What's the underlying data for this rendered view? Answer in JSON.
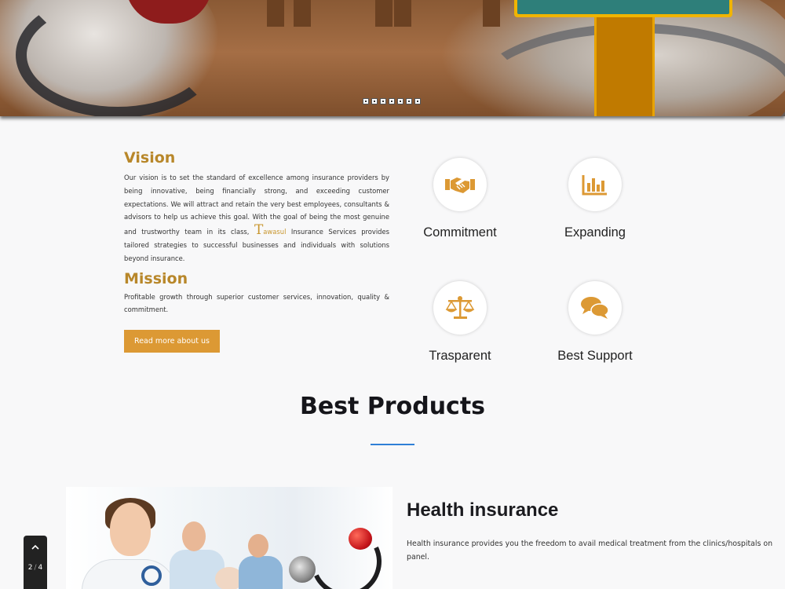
{
  "hero": {
    "slide_count": 7
  },
  "vision": {
    "heading": "Vision",
    "text_before_brand": "Our vision is to set the standard of excellence among insurance providers by being innovative, being financially strong, and exceeding customer expectations. We will attract and retain the very best employees, consultants & advisors to help us achieve this goal. With the goal of being the most genuine and trustworthy team in its class,",
    "brand_first_letter": "T",
    "brand_rest": "awasul",
    "text_after_brand": "Insurance Services provides tailored strategies to successful businesses and individuals with solutions beyond insurance."
  },
  "mission": {
    "heading": "Mission",
    "text": "Profitable growth through superior customer services, innovation, quality & commitment."
  },
  "read_more_label": "Read more about us",
  "features": [
    {
      "label": "Commitment",
      "icon": "handshake-icon"
    },
    {
      "label": "Expanding",
      "icon": "bar-chart-icon"
    },
    {
      "label": "Trasparent",
      "icon": "balance-scale-icon"
    },
    {
      "label": "Best Support",
      "icon": "chat-bubbles-icon"
    }
  ],
  "accent_colors": {
    "gold": "#b8872a",
    "button": "#dc9934",
    "blue_line": "#2f7fd6",
    "icon": "#dc9934"
  },
  "products": {
    "title": "Best Products",
    "items": [
      {
        "title": "Health insurance",
        "description": "Health insurance provides you the freedom to avail medical treatment from the clinics/hospitals on panel."
      }
    ]
  },
  "pager": {
    "current": "2",
    "separator": "/",
    "total": "4"
  }
}
